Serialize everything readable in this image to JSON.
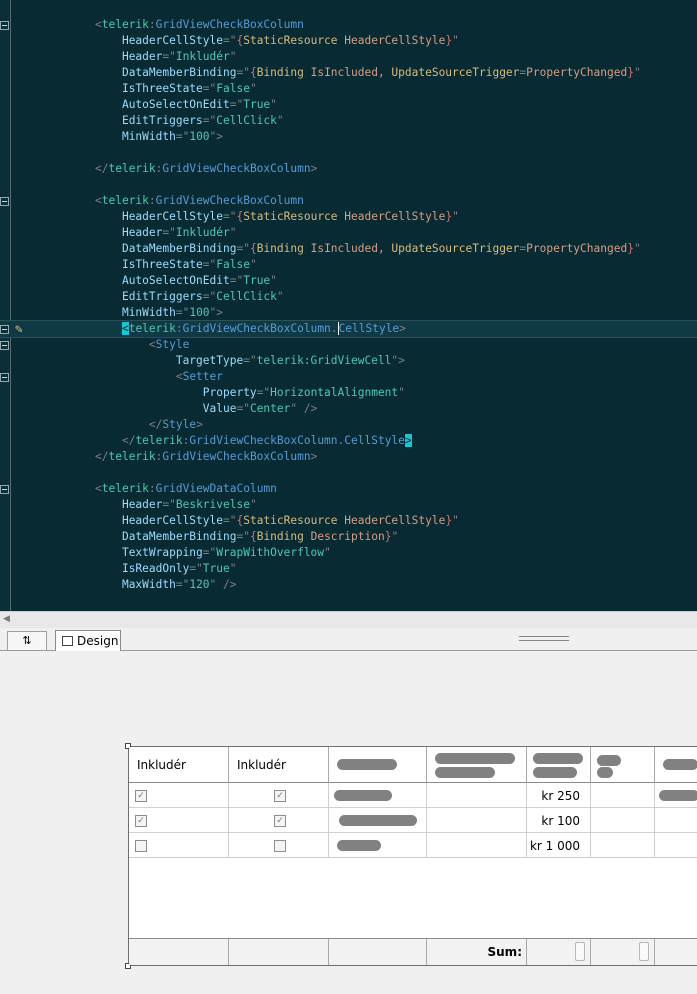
{
  "editor": {
    "lines": [
      {
        "fold": true,
        "segments": [
          [
            "b",
            "<"
          ],
          [
            "pfx",
            "telerik"
          ],
          [
            "b",
            ":"
          ],
          [
            "tag",
            "GridViewCheckBoxColumn"
          ]
        ]
      },
      {
        "segments": [
          [
            "sp",
            "    "
          ],
          [
            "attr",
            "HeaderCellStyle"
          ],
          [
            "b",
            "=\""
          ],
          [
            "mk",
            "{"
          ],
          [
            "ext",
            "StaticResource"
          ],
          [
            "val",
            " HeaderCellStyle"
          ],
          [
            "mk",
            "}"
          ],
          [
            "b",
            "\""
          ]
        ]
      },
      {
        "segments": [
          [
            "sp",
            "    "
          ],
          [
            "attr",
            "Header"
          ],
          [
            "b",
            "=\""
          ],
          [
            "str",
            "Inkludér"
          ],
          [
            "b",
            "\""
          ]
        ]
      },
      {
        "segments": [
          [
            "sp",
            "    "
          ],
          [
            "attr",
            "DataMemberBinding"
          ],
          [
            "b",
            "=\""
          ],
          [
            "mk",
            "{"
          ],
          [
            "ext",
            "Binding"
          ],
          [
            "val",
            " IsIncluded, "
          ],
          [
            "ext",
            "UpdateSourceTrigger"
          ],
          [
            "b",
            "="
          ],
          [
            "val",
            "PropertyChanged"
          ],
          [
            "mk",
            "}"
          ],
          [
            "b",
            "\""
          ]
        ]
      },
      {
        "segments": [
          [
            "sp",
            "    "
          ],
          [
            "attr",
            "IsThreeState"
          ],
          [
            "b",
            "=\""
          ],
          [
            "str",
            "False"
          ],
          [
            "b",
            "\""
          ]
        ]
      },
      {
        "segments": [
          [
            "sp",
            "    "
          ],
          [
            "attr",
            "AutoSelectOnEdit"
          ],
          [
            "b",
            "=\""
          ],
          [
            "str",
            "True"
          ],
          [
            "b",
            "\""
          ]
        ]
      },
      {
        "segments": [
          [
            "sp",
            "    "
          ],
          [
            "attr",
            "EditTriggers"
          ],
          [
            "b",
            "=\""
          ],
          [
            "str",
            "CellClick"
          ],
          [
            "b",
            "\""
          ]
        ]
      },
      {
        "segments": [
          [
            "sp",
            "    "
          ],
          [
            "attr",
            "MinWidth"
          ],
          [
            "b",
            "=\""
          ],
          [
            "str",
            "100"
          ],
          [
            "b",
            "\">"
          ]
        ]
      },
      {
        "segments": []
      },
      {
        "segments": [
          [
            "b",
            "</"
          ],
          [
            "pfx",
            "telerik"
          ],
          [
            "b",
            ":"
          ],
          [
            "tag",
            "GridViewCheckBoxColumn"
          ],
          [
            "b",
            ">"
          ]
        ]
      },
      {
        "segments": []
      },
      {
        "fold": true,
        "segments": [
          [
            "b",
            "<"
          ],
          [
            "pfx",
            "telerik"
          ],
          [
            "b",
            ":"
          ],
          [
            "tag",
            "GridViewCheckBoxColumn"
          ]
        ]
      },
      {
        "segments": [
          [
            "sp",
            "    "
          ],
          [
            "attr",
            "HeaderCellStyle"
          ],
          [
            "b",
            "=\""
          ],
          [
            "mk",
            "{"
          ],
          [
            "ext",
            "StaticResource"
          ],
          [
            "val",
            " HeaderCellStyle"
          ],
          [
            "mk",
            "}"
          ],
          [
            "b",
            "\""
          ]
        ]
      },
      {
        "segments": [
          [
            "sp",
            "    "
          ],
          [
            "attr",
            "Header"
          ],
          [
            "b",
            "=\""
          ],
          [
            "str",
            "Inkludér"
          ],
          [
            "b",
            "\""
          ]
        ]
      },
      {
        "segments": [
          [
            "sp",
            "    "
          ],
          [
            "attr",
            "DataMemberBinding"
          ],
          [
            "b",
            "=\""
          ],
          [
            "mk",
            "{"
          ],
          [
            "ext",
            "Binding"
          ],
          [
            "val",
            " IsIncluded, "
          ],
          [
            "ext",
            "UpdateSourceTrigger"
          ],
          [
            "b",
            "="
          ],
          [
            "val",
            "PropertyChanged"
          ],
          [
            "mk",
            "}"
          ],
          [
            "b",
            "\""
          ]
        ]
      },
      {
        "segments": [
          [
            "sp",
            "    "
          ],
          [
            "attr",
            "IsThreeState"
          ],
          [
            "b",
            "=\""
          ],
          [
            "str",
            "False"
          ],
          [
            "b",
            "\""
          ]
        ]
      },
      {
        "segments": [
          [
            "sp",
            "    "
          ],
          [
            "attr",
            "AutoSelectOnEdit"
          ],
          [
            "b",
            "=\""
          ],
          [
            "str",
            "True"
          ],
          [
            "b",
            "\""
          ]
        ]
      },
      {
        "segments": [
          [
            "sp",
            "    "
          ],
          [
            "attr",
            "EditTriggers"
          ],
          [
            "b",
            "=\""
          ],
          [
            "str",
            "CellClick"
          ],
          [
            "b",
            "\""
          ]
        ]
      },
      {
        "segments": [
          [
            "sp",
            "    "
          ],
          [
            "attr",
            "MinWidth"
          ],
          [
            "b",
            "=\""
          ],
          [
            "str",
            "100"
          ],
          [
            "b",
            "\">"
          ]
        ]
      },
      {
        "fold": true,
        "current": true,
        "pencil": true,
        "segments": [
          [
            "sp",
            "    "
          ],
          [
            "hl",
            "<"
          ],
          [
            "pfx",
            "telerik"
          ],
          [
            "b",
            ":"
          ],
          [
            "tag",
            "GridViewCheckBoxColumn"
          ],
          [
            "b",
            "."
          ],
          [
            "caret",
            ""
          ],
          [
            "tag",
            "CellStyle"
          ],
          [
            "b",
            ">"
          ]
        ]
      },
      {
        "fold": true,
        "segments": [
          [
            "sp",
            "        "
          ],
          [
            "b",
            "<"
          ],
          [
            "tag",
            "Style"
          ]
        ]
      },
      {
        "segments": [
          [
            "sp",
            "            "
          ],
          [
            "attr",
            "TargetType"
          ],
          [
            "b",
            "=\""
          ],
          [
            "str",
            "telerik:GridViewCell"
          ],
          [
            "b",
            "\">"
          ]
        ]
      },
      {
        "fold": true,
        "segments": [
          [
            "sp",
            "            "
          ],
          [
            "b",
            "<"
          ],
          [
            "tag",
            "Setter"
          ]
        ]
      },
      {
        "segments": [
          [
            "sp",
            "                "
          ],
          [
            "attr",
            "Property"
          ],
          [
            "b",
            "=\""
          ],
          [
            "str",
            "HorizontalAlignment"
          ],
          [
            "b",
            "\""
          ]
        ]
      },
      {
        "segments": [
          [
            "sp",
            "                "
          ],
          [
            "attr",
            "Value"
          ],
          [
            "b",
            "=\""
          ],
          [
            "str",
            "Center"
          ],
          [
            "b",
            "\" />"
          ]
        ]
      },
      {
        "segments": [
          [
            "sp",
            "        "
          ],
          [
            "b",
            "</"
          ],
          [
            "tag",
            "Style"
          ],
          [
            "b",
            ">"
          ]
        ]
      },
      {
        "segments": [
          [
            "sp",
            "    "
          ],
          [
            "b",
            "</"
          ],
          [
            "pfx",
            "telerik"
          ],
          [
            "b",
            ":"
          ],
          [
            "tag",
            "GridViewCheckBoxColumn"
          ],
          [
            "b",
            "."
          ],
          [
            "tag",
            "CellStyle"
          ],
          [
            "hl",
            ">"
          ]
        ]
      },
      {
        "segments": [
          [
            "b",
            "</"
          ],
          [
            "pfx",
            "telerik"
          ],
          [
            "b",
            ":"
          ],
          [
            "tag",
            "GridViewCheckBoxColumn"
          ],
          [
            "b",
            ">"
          ]
        ]
      },
      {
        "segments": []
      },
      {
        "fold": true,
        "segments": [
          [
            "b",
            "<"
          ],
          [
            "pfx",
            "telerik"
          ],
          [
            "b",
            ":"
          ],
          [
            "tag",
            "GridViewDataColumn"
          ]
        ]
      },
      {
        "segments": [
          [
            "sp",
            "    "
          ],
          [
            "attr",
            "Header"
          ],
          [
            "b",
            "=\""
          ],
          [
            "str",
            "Beskrivelse"
          ],
          [
            "b",
            "\""
          ]
        ]
      },
      {
        "segments": [
          [
            "sp",
            "    "
          ],
          [
            "attr",
            "HeaderCellStyle"
          ],
          [
            "b",
            "=\""
          ],
          [
            "mk",
            "{"
          ],
          [
            "ext",
            "StaticResource"
          ],
          [
            "val",
            " HeaderCellStyle"
          ],
          [
            "mk",
            "}"
          ],
          [
            "b",
            "\""
          ]
        ]
      },
      {
        "segments": [
          [
            "sp",
            "    "
          ],
          [
            "attr",
            "DataMemberBinding"
          ],
          [
            "b",
            "=\""
          ],
          [
            "mk",
            "{"
          ],
          [
            "ext",
            "Binding"
          ],
          [
            "val",
            " Description"
          ],
          [
            "mk",
            "}"
          ],
          [
            "b",
            "\""
          ]
        ]
      },
      {
        "segments": [
          [
            "sp",
            "    "
          ],
          [
            "attr",
            "TextWrapping"
          ],
          [
            "b",
            "=\""
          ],
          [
            "str",
            "WrapWithOverflow"
          ],
          [
            "b",
            "\""
          ]
        ]
      },
      {
        "segments": [
          [
            "sp",
            "    "
          ],
          [
            "attr",
            "IsReadOnly"
          ],
          [
            "b",
            "=\""
          ],
          [
            "str",
            "True"
          ],
          [
            "b",
            "\""
          ]
        ]
      },
      {
        "segments": [
          [
            "sp",
            "    "
          ],
          [
            "attr",
            "MaxWidth"
          ],
          [
            "b",
            "=\""
          ],
          [
            "str",
            "120"
          ],
          [
            "b",
            "\" />"
          ]
        ]
      }
    ]
  },
  "tabs": {
    "swap_label": "⇅",
    "design_label": "Design"
  },
  "grid": {
    "headers": [
      "Inkludér",
      "Inkludér"
    ],
    "rows": [
      {
        "checked1": true,
        "checked2": true,
        "price": "kr 250"
      },
      {
        "checked1": true,
        "checked2": true,
        "price": "kr 100"
      },
      {
        "checked1": false,
        "checked2": false,
        "price": "kr 1 000"
      }
    ],
    "footer_label": "Sum:"
  }
}
